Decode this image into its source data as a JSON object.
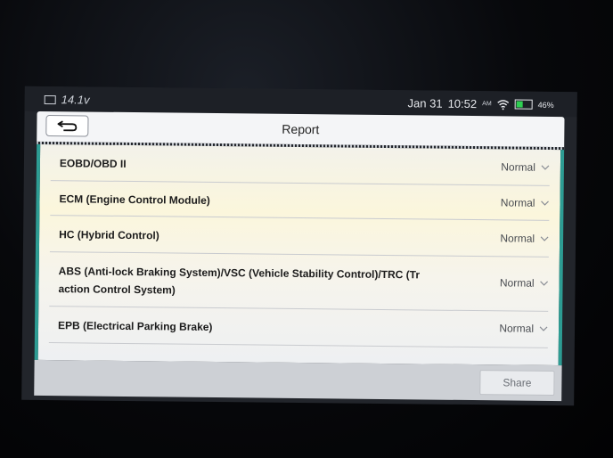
{
  "status_bar": {
    "voltage": "14.1v",
    "date": "Jan 31",
    "time": "10:52",
    "ampm": "AM",
    "battery_pct": "46%",
    "battery_level": 0.46
  },
  "header": {
    "title": "Report",
    "back_icon": "back-arrow-icon"
  },
  "report_rows": [
    {
      "label": "EOBD/OBD II",
      "status": "Normal"
    },
    {
      "label": "ECM (Engine Control Module)",
      "status": "Normal"
    },
    {
      "label": "HC (Hybrid Control)",
      "status": "Normal"
    },
    {
      "label_line1": "ABS (Anti-lock Braking System)/VSC (Vehicle Stability Control)/TRC (Tr",
      "label_line2": "action Control System)",
      "status": "Normal"
    },
    {
      "label": "EPB (Electrical Parking Brake)",
      "status": "Normal"
    }
  ],
  "footer": {
    "share_label": "Share"
  },
  "colors": {
    "accent_teal": "#2d9c93",
    "battery_green": "#2fcf52"
  }
}
